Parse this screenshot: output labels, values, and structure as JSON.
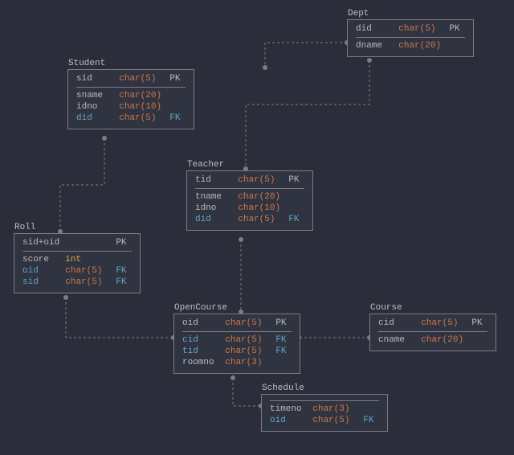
{
  "entities": {
    "dept": {
      "title": "Dept",
      "cols": [
        {
          "name": "did",
          "type": "char(5)",
          "key": "PK"
        },
        {
          "name": "dname",
          "type": "char(20)",
          "key": ""
        }
      ]
    },
    "student": {
      "title": "Student",
      "cols": [
        {
          "name": "sid",
          "type": "char(5)",
          "key": "PK"
        },
        {
          "name": "sname",
          "type": "char(20)",
          "key": ""
        },
        {
          "name": "idno",
          "type": "char(10)",
          "key": ""
        },
        {
          "name": "did",
          "type": "char(5)",
          "key": "FK"
        }
      ]
    },
    "teacher": {
      "title": "Teacher",
      "cols": [
        {
          "name": "tid",
          "type": "char(5)",
          "key": "PK"
        },
        {
          "name": "tname",
          "type": "char(20)",
          "key": ""
        },
        {
          "name": "idno",
          "type": "char(10)",
          "key": ""
        },
        {
          "name": "did",
          "type": "char(5)",
          "key": "FK"
        }
      ]
    },
    "roll": {
      "title": "Roll",
      "cols": [
        {
          "name": "sid+oid",
          "type": "",
          "key": "PK"
        },
        {
          "name": "score",
          "type": "int",
          "key": ""
        },
        {
          "name": "oid",
          "type": "char(5)",
          "key": "FK"
        },
        {
          "name": "sid",
          "type": "char(5)",
          "key": "FK"
        }
      ]
    },
    "opencourse": {
      "title": "OpenCourse",
      "cols": [
        {
          "name": "oid",
          "type": "char(5)",
          "key": "PK"
        },
        {
          "name": "cid",
          "type": "char(5)",
          "key": "FK"
        },
        {
          "name": "tid",
          "type": "char(5)",
          "key": "FK"
        },
        {
          "name": "roomno",
          "type": "char(3)",
          "key": ""
        }
      ]
    },
    "course": {
      "title": "Course",
      "cols": [
        {
          "name": "cid",
          "type": "char(5)",
          "key": "PK"
        },
        {
          "name": "cname",
          "type": "char(20)",
          "key": ""
        }
      ]
    },
    "schedule": {
      "title": "Schedule",
      "cols": [
        {
          "name": "",
          "type": "",
          "key": ""
        },
        {
          "name": "timeno",
          "type": "char(3)",
          "key": ""
        },
        {
          "name": "oid",
          "type": "char(5)",
          "key": "FK"
        }
      ]
    }
  }
}
